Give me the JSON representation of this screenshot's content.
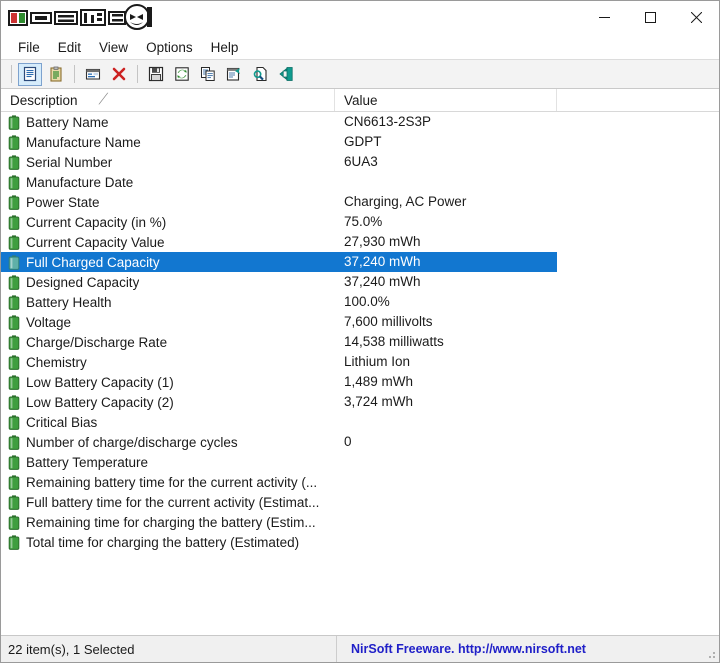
{
  "window": {
    "title_logo_alt": "BatteryInfoView",
    "controls": [
      {
        "name": "minimize-button",
        "glyph": "minimize"
      },
      {
        "name": "maximize-button",
        "glyph": "maximize"
      },
      {
        "name": "close-button",
        "glyph": "close"
      }
    ]
  },
  "menu": {
    "items": [
      {
        "label": "File"
      },
      {
        "label": "Edit"
      },
      {
        "label": "View"
      },
      {
        "label": "Options"
      },
      {
        "label": "Help"
      }
    ]
  },
  "toolbar": {
    "buttons": [
      {
        "name": "battery-information-button",
        "icon": "document-lines-icon",
        "active": true
      },
      {
        "name": "battery-log-button",
        "icon": "clipboard-icon",
        "active": false
      },
      {
        "name": "properties-window-button",
        "icon": "window-icon",
        "active": false
      },
      {
        "name": "delete-button",
        "icon": "red-x-icon",
        "active": false
      },
      {
        "name": "save-button",
        "icon": "floppy-disk-icon",
        "active": false
      },
      {
        "name": "refresh-button",
        "icon": "refresh-icon",
        "active": false
      },
      {
        "name": "copy-button",
        "icon": "copy-icon",
        "active": false
      },
      {
        "name": "properties-button",
        "icon": "properties-icon",
        "active": false
      },
      {
        "name": "find-button",
        "icon": "find-icon",
        "active": false
      },
      {
        "name": "exit-button",
        "icon": "exit-door-icon",
        "active": false
      }
    ]
  },
  "listview": {
    "columns": [
      {
        "label": "Description",
        "sort_indicator": "╱"
      },
      {
        "label": "Value"
      },
      {
        "label": ""
      }
    ],
    "rows": [
      {
        "description": "Battery Name",
        "value": "CN6613-2S3P",
        "selected": false
      },
      {
        "description": "Manufacture Name",
        "value": "GDPT",
        "selected": false
      },
      {
        "description": "Serial Number",
        "value": "6UA3",
        "selected": false
      },
      {
        "description": "Manufacture Date",
        "value": "",
        "selected": false
      },
      {
        "description": "Power State",
        "value": "Charging, AC Power",
        "selected": false
      },
      {
        "description": "Current Capacity (in %)",
        "value": "75.0%",
        "selected": false
      },
      {
        "description": "Current Capacity Value",
        "value": "27,930 mWh",
        "selected": false
      },
      {
        "description": "Full Charged Capacity",
        "value": "37,240 mWh",
        "selected": true
      },
      {
        "description": "Designed Capacity",
        "value": "37,240 mWh",
        "selected": false
      },
      {
        "description": "Battery Health",
        "value": "100.0%",
        "selected": false
      },
      {
        "description": "Voltage",
        "value": "7,600 millivolts",
        "selected": false
      },
      {
        "description": "Charge/Discharge Rate",
        "value": "14,538 milliwatts",
        "selected": false
      },
      {
        "description": "Chemistry",
        "value": "Lithium Ion",
        "selected": false
      },
      {
        "description": "Low Battery Capacity (1)",
        "value": "1,489 mWh",
        "selected": false
      },
      {
        "description": "Low Battery Capacity (2)",
        "value": "3,724 mWh",
        "selected": false
      },
      {
        "description": "Critical Bias",
        "value": "",
        "selected": false
      },
      {
        "description": "Number of charge/discharge cycles",
        "value": "0",
        "selected": false
      },
      {
        "description": "Battery Temperature",
        "value": "",
        "selected": false
      },
      {
        "description": "Remaining battery time for the current activity (...",
        "value": "",
        "selected": false
      },
      {
        "description": "Full battery time for the current activity (Estimat...",
        "value": "",
        "selected": false
      },
      {
        "description": "Remaining time for charging the battery (Estim...",
        "value": "",
        "selected": false
      },
      {
        "description": "Total  time for charging the battery (Estimated)",
        "value": "",
        "selected": false
      }
    ]
  },
  "statusbar": {
    "item_count_text": "22 item(s), 1 Selected",
    "link_text": "NirSoft Freeware.  http://www.nirsoft.net"
  },
  "colors": {
    "selection_blue": "#1277d0",
    "battery_green": "#3f9e3f",
    "link_blue": "#2020c8",
    "toolbar_bg": "#f3f3f3",
    "statusbar_bg": "#f0f0f0"
  }
}
